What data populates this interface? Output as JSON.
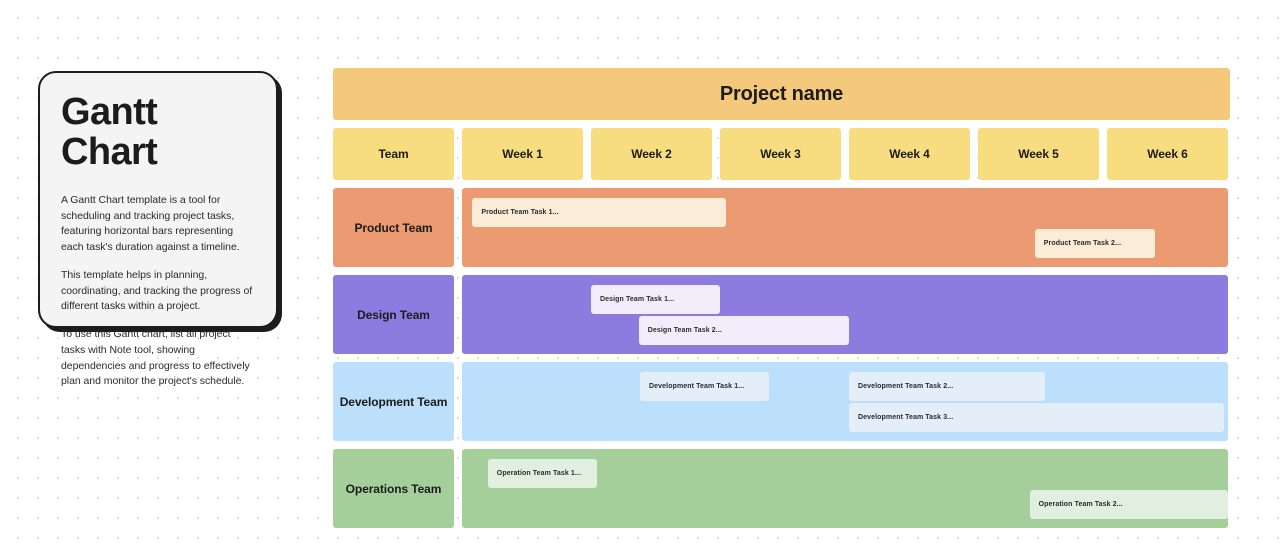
{
  "info_card": {
    "title": "Gantt Chart",
    "paragraphs": [
      "A Gantt Chart template is a tool for scheduling and tracking project tasks, featuring horizontal bars representing each task's duration against a timeline.",
      "This template helps in planning, coordinating, and tracking the progress of different tasks within a project.",
      "To use this Gantt chart, list all project tasks with Note tool, showing dependencies and progress to effectively plan and monitor the project's schedule."
    ]
  },
  "chart_data": {
    "type": "bar",
    "title": "Project name",
    "xlabel": "",
    "ylabel": "",
    "grid": false,
    "legend": "none",
    "axis_unit": "week",
    "columns": [
      "Team",
      "Week 1",
      "Week 2",
      "Week 3",
      "Week 4",
      "Week 5",
      "Week 6"
    ],
    "week_labels": [
      "Week 1",
      "Week 2",
      "Week 3",
      "Week 4",
      "Week 5",
      "Week 6"
    ],
    "team_header": "Team",
    "xlim": [
      1,
      6
    ],
    "rows": [
      {
        "team": "Product Team",
        "row_color": "#eb9a72",
        "bar_color": "#faecd6",
        "tasks": [
          {
            "label": "Product Team Task 1...",
            "start_week": 1.08,
            "end_week": 3.05,
            "lane": 0
          },
          {
            "label": "Product Team Task 2...",
            "start_week": 5.44,
            "end_week": 6.37,
            "lane": 1
          }
        ]
      },
      {
        "team": "Design Team",
        "row_color": "#8c7ce0",
        "bar_color": "#f3edfb",
        "tasks": [
          {
            "label": "Design Team Task 1...",
            "start_week": 2.0,
            "end_week": 3.0,
            "lane": 0
          },
          {
            "label": "Design Team Task 2...",
            "start_week": 2.37,
            "end_week": 4.0,
            "lane": 1
          }
        ]
      },
      {
        "team": "Development Team",
        "row_color": "#bcdffb",
        "bar_color": "#e3eef9",
        "tasks": [
          {
            "label": "Development Team Task 1...",
            "start_week": 2.38,
            "end_week": 3.38,
            "lane": 0
          },
          {
            "label": "Development Team Task 2...",
            "start_week": 4.0,
            "end_week": 5.52,
            "lane": 0
          },
          {
            "label": "Development Team Task 3...",
            "start_week": 4.0,
            "end_week": 6.91,
            "lane": 1
          }
        ]
      },
      {
        "team": "Operations Team",
        "row_color": "#a5cf9a",
        "bar_color": "#e0efe0",
        "tasks": [
          {
            "label": "Operation Team Task 1...",
            "start_week": 1.2,
            "end_week": 2.05,
            "lane": 0
          },
          {
            "label": "Operation Team Task 2...",
            "start_week": 5.4,
            "end_week": 7.2,
            "lane": 1
          }
        ]
      }
    ],
    "colors": {
      "title_bar": "#f5c97c",
      "header_cell": "#f7dd7f",
      "canvas": "#ffffff",
      "dot_grid": "#dcdcdc",
      "card_bg": "#f4f4f4",
      "card_border": "#1c1c1c",
      "text": "#1c1c1c"
    }
  }
}
